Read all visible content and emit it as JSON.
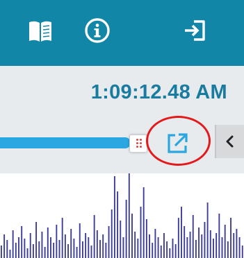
{
  "header": {
    "icons": [
      "book-open-icon",
      "info-icon",
      "sign-in-icon"
    ],
    "background": "#1286a6"
  },
  "panel": {
    "time": "1:09:12.48 AM",
    "progress": 1.0,
    "open_icon": "external-link-icon",
    "collapse_icon": "chevron-left-icon"
  },
  "annotation": {
    "color": "#e3191c"
  },
  "chart_data": {
    "type": "bar",
    "color": "#3b3b9a",
    "values": [
      18,
      34,
      26,
      12,
      40,
      22,
      30,
      46,
      28,
      14,
      36,
      20,
      52,
      24,
      38,
      16,
      44,
      30,
      22,
      48,
      26,
      58,
      34,
      20,
      42,
      28,
      16,
      50,
      24,
      36,
      30,
      18,
      62,
      40,
      26,
      34,
      22,
      46,
      70,
      118,
      96,
      54,
      30,
      84,
      122,
      64,
      38,
      28,
      74,
      102,
      56,
      34,
      22,
      42,
      30,
      18,
      36,
      24,
      14,
      28,
      20,
      58,
      74,
      46,
      30,
      38,
      62,
      26,
      44,
      34,
      52,
      80,
      40,
      28,
      36,
      64,
      30,
      48,
      24,
      58,
      36,
      42,
      30,
      18
    ]
  }
}
